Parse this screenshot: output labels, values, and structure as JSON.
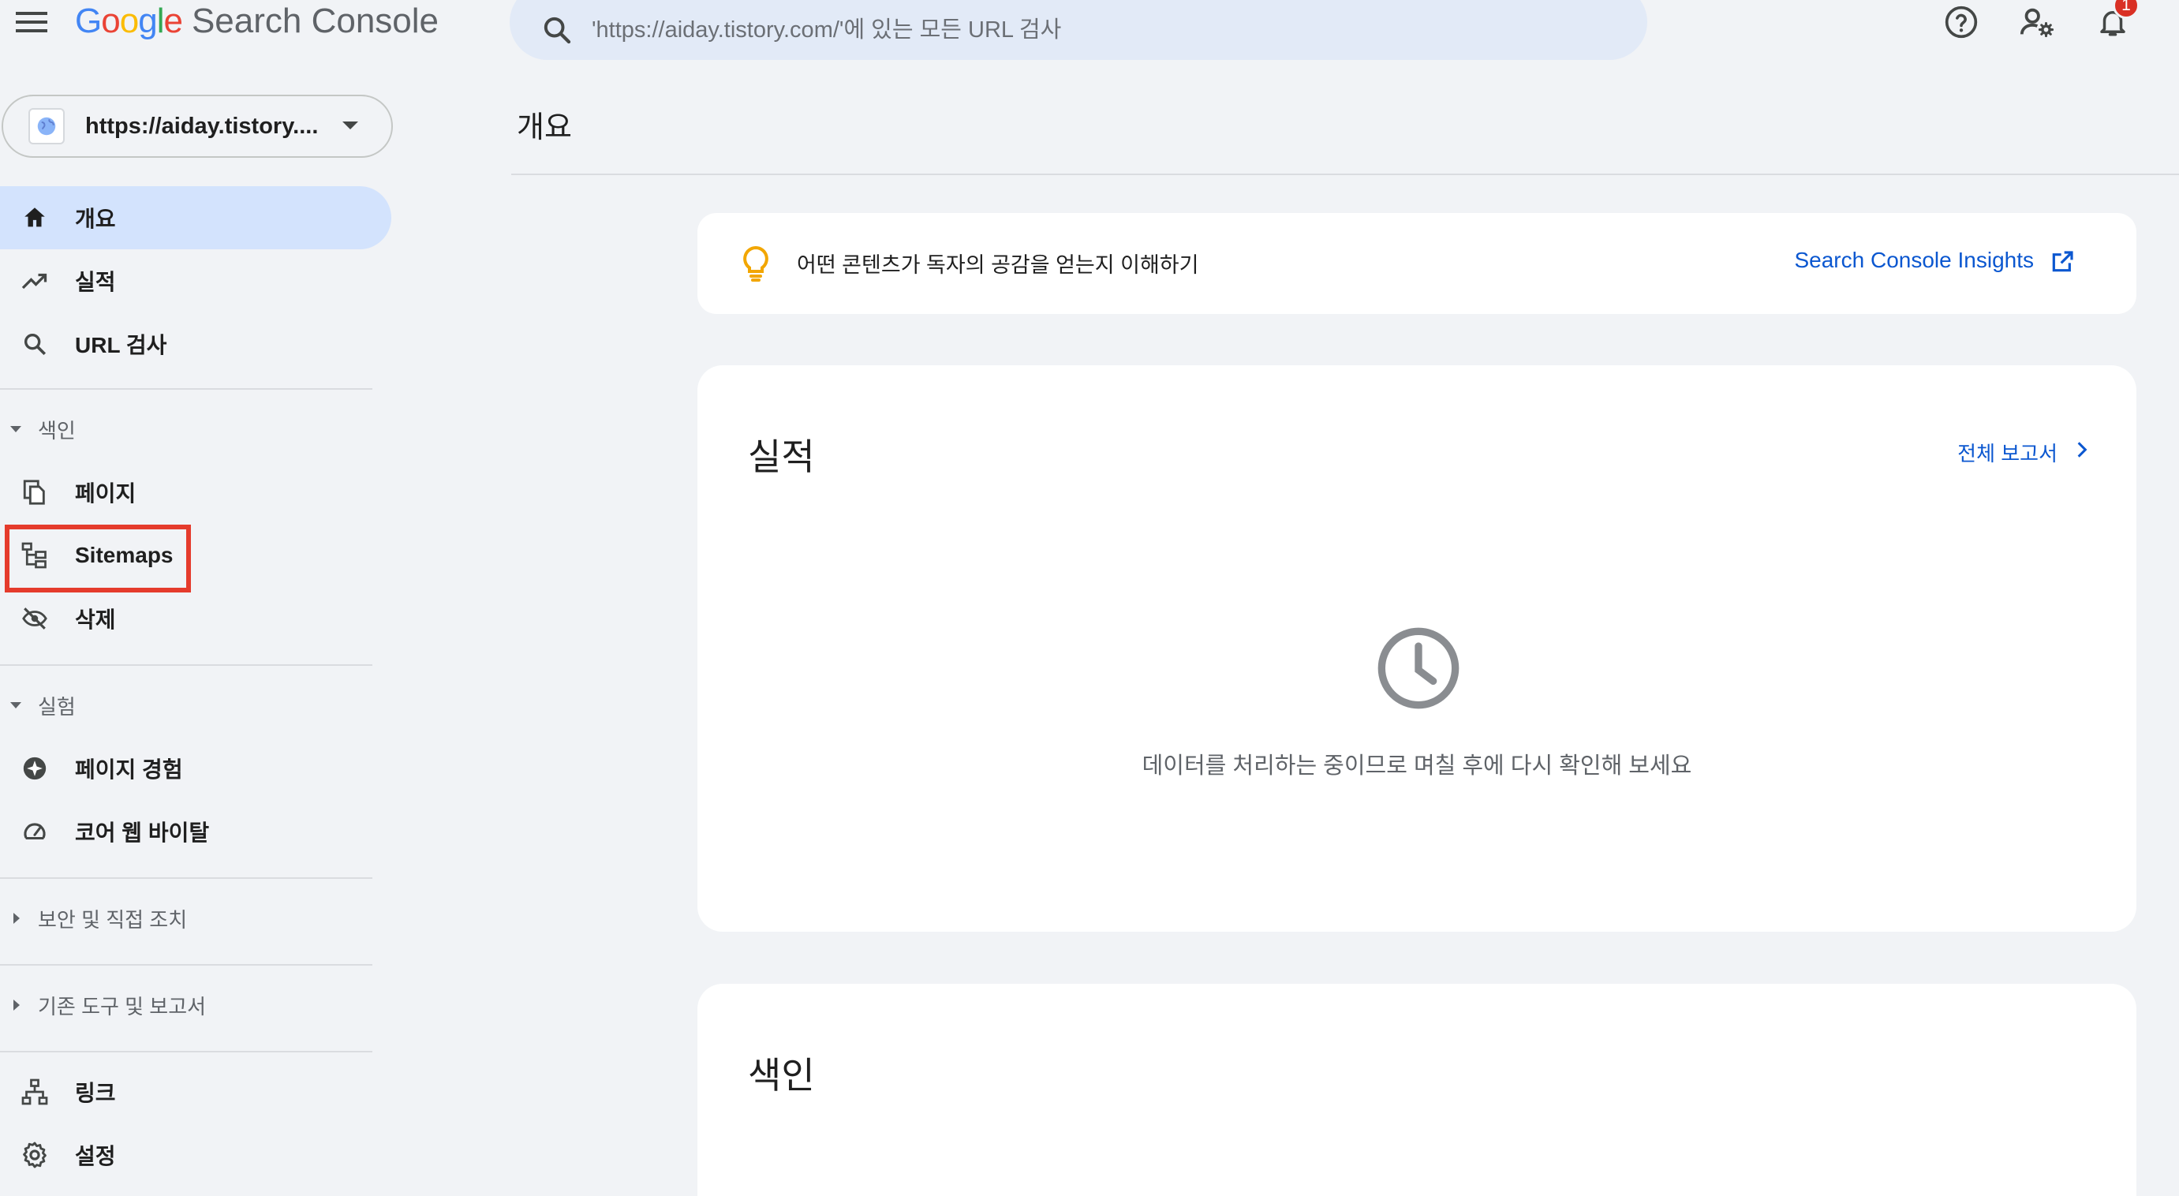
{
  "app": {
    "logo_google": "Google",
    "logo_product": "Search Console",
    "brand_colors": [
      "#4285f4",
      "#ea4335",
      "#fbbc05",
      "#34a853"
    ]
  },
  "search": {
    "placeholder": "'https://aiday.tistory.com/'에 있는 모든 URL 검사"
  },
  "topbar": {
    "notifications_count": "1"
  },
  "property": {
    "label": "https://aiday.tistory...."
  },
  "sidebar": {
    "overview": "개요",
    "performance": "실적",
    "url_inspection": "URL 검사",
    "section_index": "색인",
    "pages": "페이지",
    "sitemaps": "Sitemaps",
    "removals": "삭제",
    "section_experience": "실험",
    "page_experience": "페이지 경험",
    "core_web_vitals": "코어 웹 바이탈",
    "section_security": "보안 및 직접 조치",
    "section_legacy": "기존 도구 및 보고서",
    "links": "링크",
    "settings": "설정"
  },
  "main": {
    "page_title": "개요",
    "insight_text": "어떤 콘텐츠가 독자의 공감을 얻는지 이해하기",
    "insight_link": "Search Console Insights",
    "perf_title": "실적",
    "perf_full_report": "전체 보고서",
    "perf_message": "데이터를 처리하는 중이므로 며칠 후에 다시 확인해 보세요",
    "index_title": "색인"
  },
  "colors": {
    "accent": "#0b57d0",
    "active_nav": "#d3e3fd",
    "highlight": "#e53b2c",
    "bulb": "#f2a600"
  }
}
